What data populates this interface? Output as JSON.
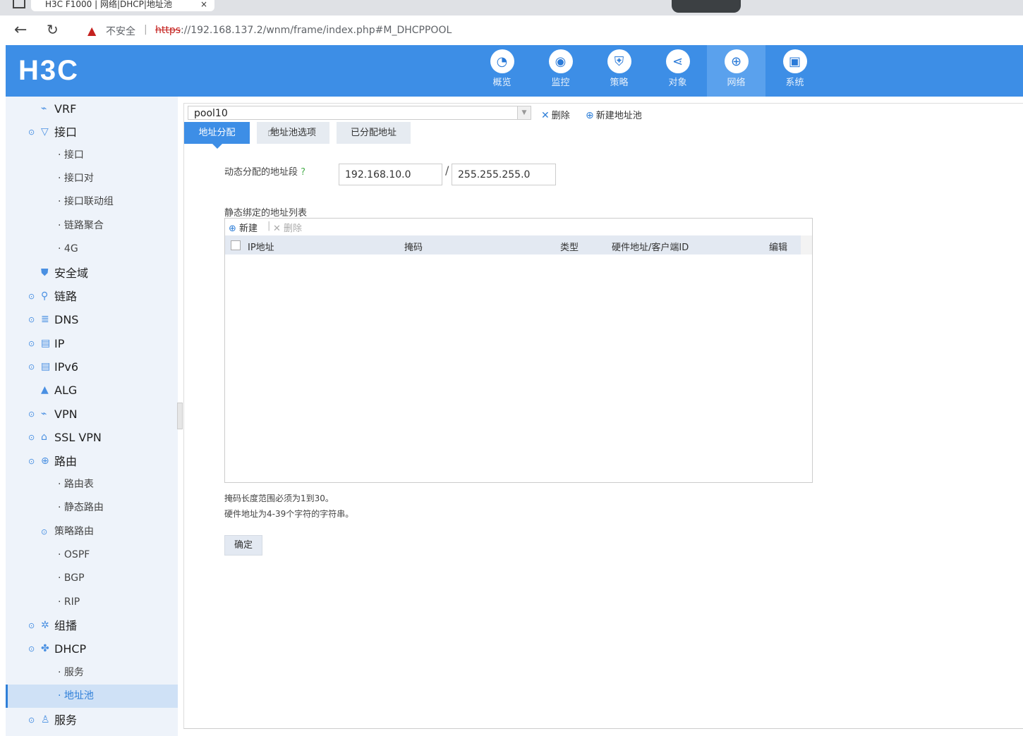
{
  "browser": {
    "tab_title": "H3C F1000 | 网络|DHCP|地址池",
    "tab_close": "×",
    "insecure_label": "不安全",
    "url_scheme": "https",
    "url_rest": "://192.168.137.2/wnm/frame/index.php#M_DHCPPOOL"
  },
  "header": {
    "logo": "H3C",
    "nav": [
      {
        "label": "概览",
        "icon": "gauge-icon"
      },
      {
        "label": "监控",
        "icon": "monitor-icon"
      },
      {
        "label": "策略",
        "icon": "shield-icon"
      },
      {
        "label": "对象",
        "icon": "share-icon"
      },
      {
        "label": "网络",
        "icon": "globe-icon",
        "active": true
      },
      {
        "label": "系统",
        "icon": "system-icon"
      }
    ]
  },
  "sidebar": {
    "items": [
      {
        "label": "VRF"
      },
      {
        "label": "接口"
      },
      {
        "label": "接口"
      },
      {
        "label": "接口对"
      },
      {
        "label": "接口联动组"
      },
      {
        "label": "链路聚合"
      },
      {
        "label": "4G"
      },
      {
        "label": "安全域"
      },
      {
        "label": "链路"
      },
      {
        "label": "DNS"
      },
      {
        "label": "IP"
      },
      {
        "label": "IPv6"
      },
      {
        "label": "ALG"
      },
      {
        "label": "VPN"
      },
      {
        "label": "SSL VPN"
      },
      {
        "label": "路由"
      },
      {
        "label": "路由表"
      },
      {
        "label": "静态路由"
      },
      {
        "label": "策略路由"
      },
      {
        "label": "OSPF"
      },
      {
        "label": "BGP"
      },
      {
        "label": "RIP"
      },
      {
        "label": "组播"
      },
      {
        "label": "DHCP"
      },
      {
        "label": "服务"
      },
      {
        "label": "地址池",
        "active": true
      },
      {
        "label": "服务"
      }
    ]
  },
  "main": {
    "pool_select": "pool10",
    "delete_label": "删除",
    "new_pool_label": "新建地址池",
    "tabs": [
      {
        "label": "地址分配",
        "active": true
      },
      {
        "label": "地址池选项"
      },
      {
        "label": "已分配地址"
      }
    ],
    "dynamic_label": "动态分配的地址段",
    "help_icon": "?",
    "ip_value": "192.168.10.0",
    "mask_value": "255.255.255.0",
    "slash": "/",
    "static_label": "静态绑定的地址列表",
    "grid": {
      "new_label": "新建",
      "delete_label": "删除",
      "columns": [
        "IP地址",
        "掩码",
        "类型",
        "硬件地址/客户端ID",
        "编辑"
      ],
      "rows": []
    },
    "notes": [
      "掩码长度范围必须为1到30。",
      "硬件地址为4-39个字符的字符串。"
    ],
    "ok_label": "确定"
  },
  "colors": {
    "brand": "#3d8ee6",
    "active_nav": "#5aa1ed",
    "sidebar_bg": "#eef3fa"
  }
}
